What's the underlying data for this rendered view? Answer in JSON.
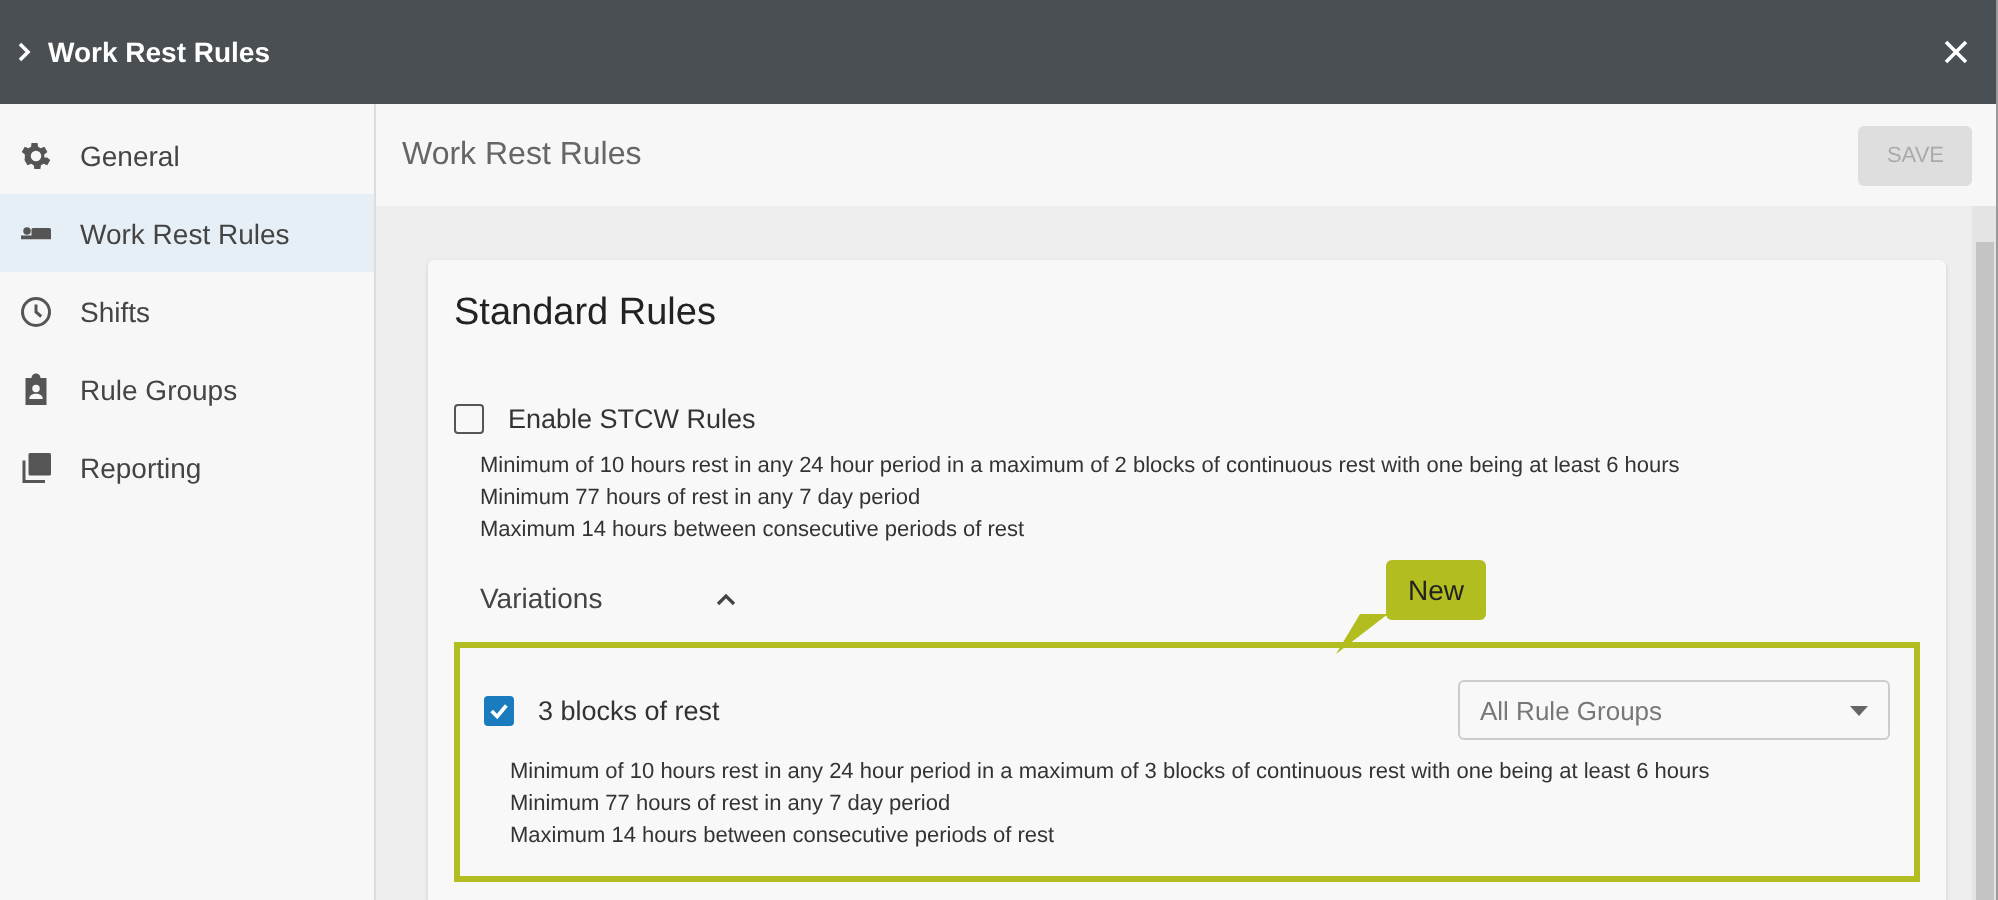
{
  "header": {
    "title": "Work Rest Rules"
  },
  "sidebar": {
    "items": [
      {
        "label": "General",
        "selected": false
      },
      {
        "label": "Work Rest Rules",
        "selected": true
      },
      {
        "label": "Shifts",
        "selected": false
      },
      {
        "label": "Rule Groups",
        "selected": false
      },
      {
        "label": "Reporting",
        "selected": false
      }
    ]
  },
  "page": {
    "title": "Work Rest Rules",
    "save_button": {
      "label": "SAVE",
      "disabled": true
    }
  },
  "card": {
    "title": "Standard Rules",
    "rule_set": {
      "label": "Enable STCW Rules",
      "checked": false,
      "rules": [
        "Minimum of 10 hours rest in any 24 hour period in a maximum of 2 blocks of continuous rest with one being at least 6 hours",
        "Minimum 77 hours of rest in any 7 day period",
        "Maximum 14 hours between consecutive periods of rest"
      ]
    },
    "variations": {
      "label": "Variations",
      "expanded": true,
      "items": [
        {
          "label": "3 blocks of rest",
          "checked": true,
          "dropdown": "All Rule Groups",
          "rules": [
            "Minimum of 10 hours rest in any 24 hour period in a maximum of 3 blocks of continuous rest with one being at least 6 hours",
            "Minimum 77 hours of rest in any 7 day period",
            "Maximum 14 hours between consecutive periods of rest"
          ]
        }
      ]
    }
  },
  "callout": {
    "text": "New"
  }
}
